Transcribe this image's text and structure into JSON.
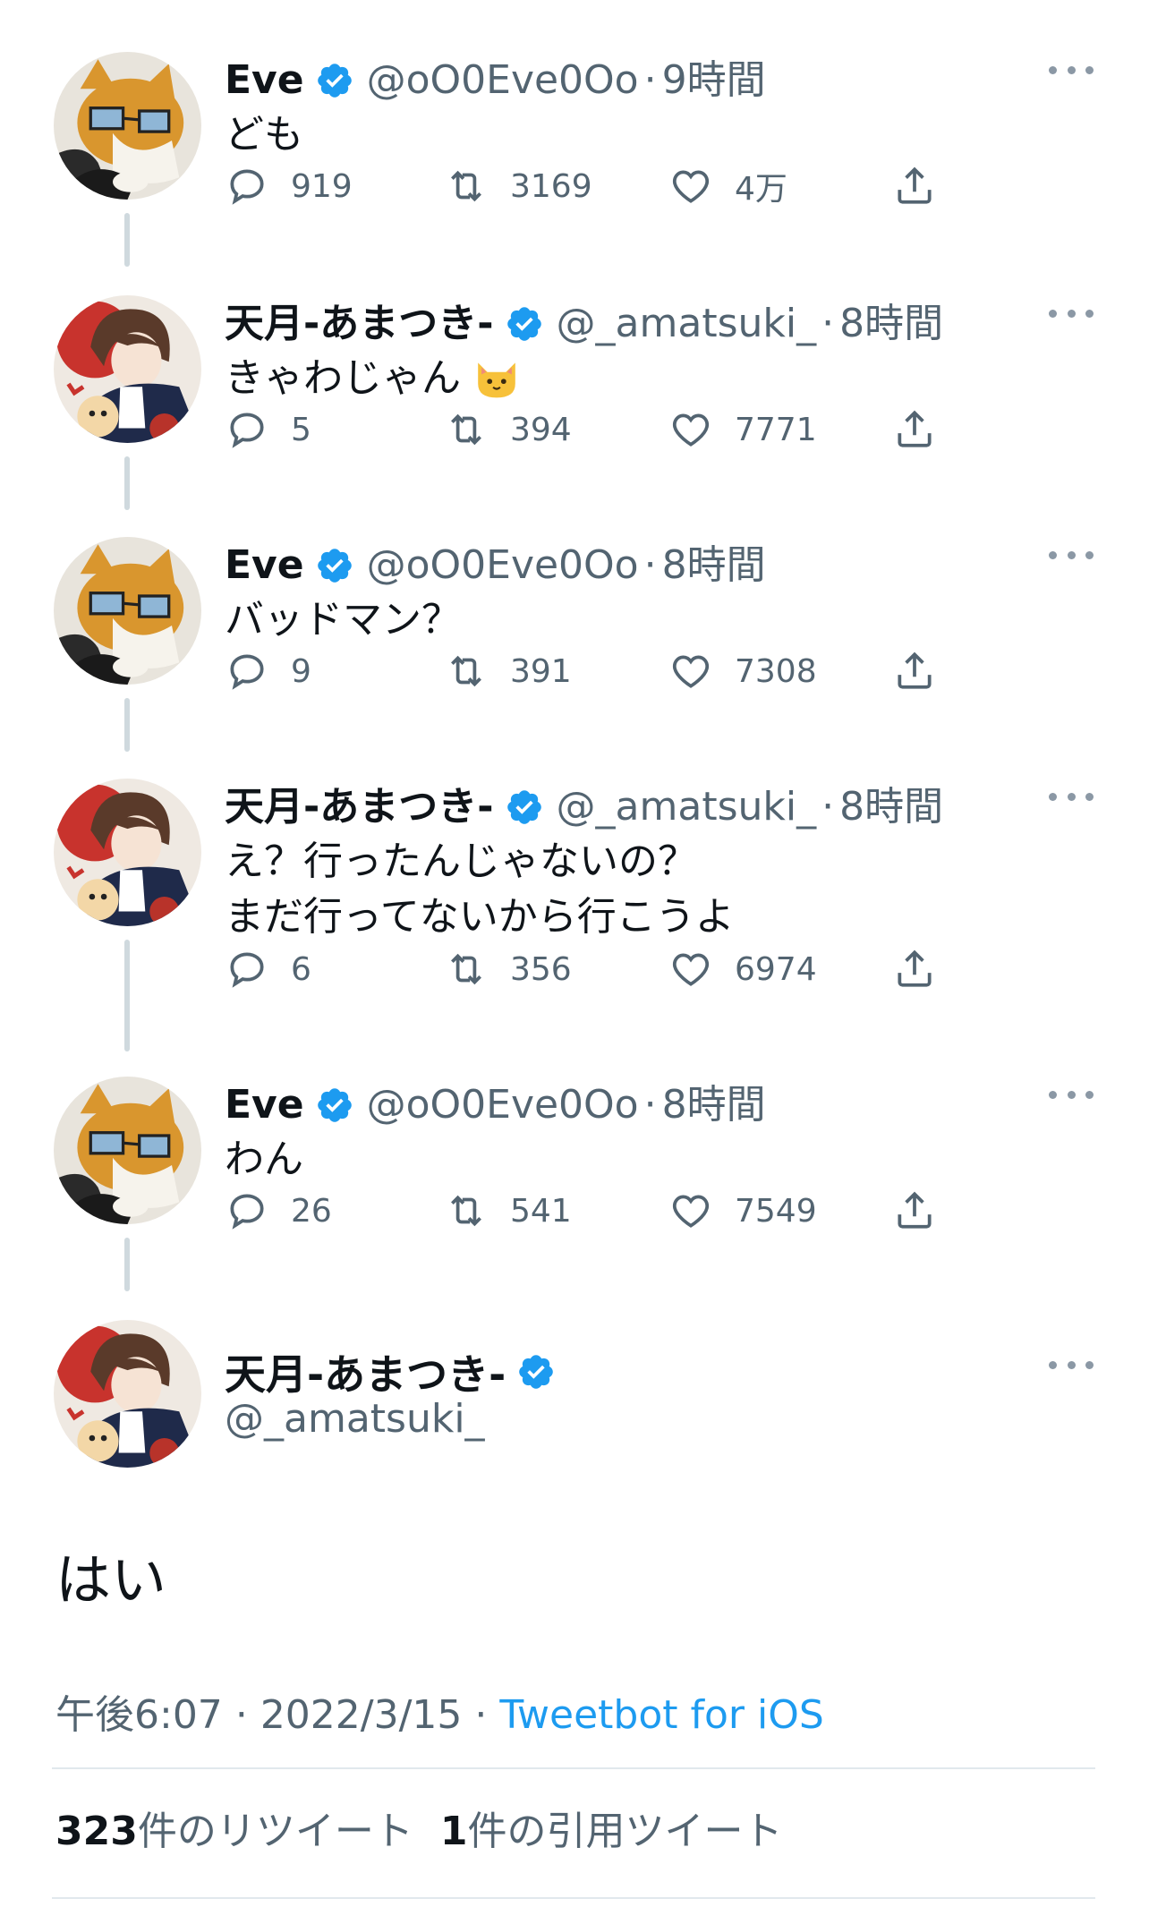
{
  "tweets": [
    {
      "name": "Eve",
      "handle": "@oO0Eve0Oo",
      "time": "9時間",
      "text": "ども",
      "replies": "919",
      "retweets": "3169",
      "likes": "4万",
      "avatar": "cat"
    },
    {
      "name": "天月-あまつき-",
      "handle": "@_amatsuki_",
      "time": "8時間",
      "text": "きゃわじゃん",
      "emoji": "cat-face-emoji",
      "replies": "5",
      "retweets": "394",
      "likes": "7771",
      "avatar": "boy"
    },
    {
      "name": "Eve",
      "handle": "@oO0Eve0Oo",
      "time": "8時間",
      "text": "バッドマン？",
      "replies": "9",
      "retweets": "391",
      "likes": "7308",
      "avatar": "cat"
    },
    {
      "name": "天月-あまつき-",
      "handle": "@_amatsuki_",
      "time": "8時間",
      "text": "え？行ったんじゃないの？\nまだ行ってないから行こうよ",
      "replies": "6",
      "retweets": "356",
      "likes": "6974",
      "avatar": "boy"
    },
    {
      "name": "Eve",
      "handle": "@oO0Eve0Oo",
      "time": "8時間",
      "text": "わん",
      "replies": "26",
      "retweets": "541",
      "likes": "7549",
      "avatar": "cat"
    }
  ],
  "main_tweet": {
    "name": "天月-あまつき-",
    "handle": "@_amatsuki_",
    "text": "はい",
    "time": "午後6:07",
    "date": "2022/3/15",
    "separator": "·",
    "client": "Tweetbot for iOS",
    "retweet_count": "323",
    "retweet_label": "件のリツイート",
    "quote_count": "1",
    "quote_label": "件の引用ツイート"
  },
  "colors": {
    "verified": "#1d9bf0",
    "link": "#1d9bf0",
    "secondary_text": "#536471",
    "thread_line": "#cfd9de"
  }
}
